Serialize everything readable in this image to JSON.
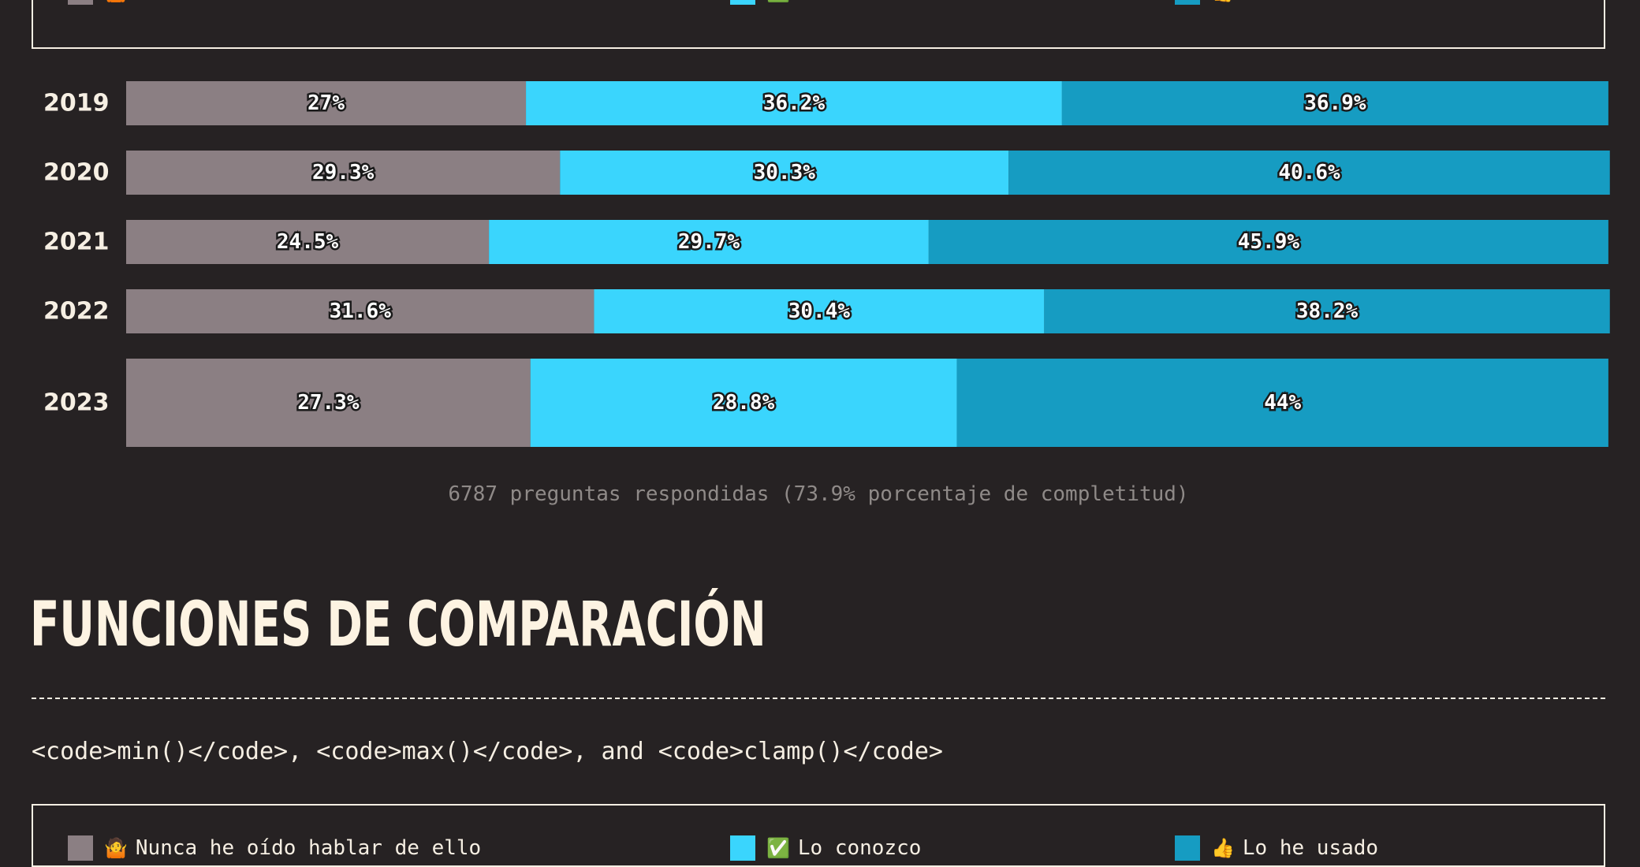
{
  "legend": {
    "items": [
      {
        "emoji": "🤷",
        "label": "Nunca he oído hablar de ello",
        "color": "#8b7f83"
      },
      {
        "emoji": "✅",
        "label": "Lo conozco",
        "color": "#3ad5fd"
      },
      {
        "emoji": "👍",
        "label": "Lo he usado",
        "color": "#169cc2"
      }
    ]
  },
  "chart_data": {
    "type": "bar",
    "orientation": "horizontal",
    "stacked": true,
    "normalized": true,
    "categories": [
      "2019",
      "2020",
      "2021",
      "2022",
      "2023"
    ],
    "series": [
      {
        "name": "Nunca he oído hablar de ello",
        "color": "#8b7f83",
        "values": [
          27,
          29.3,
          24.5,
          31.6,
          27.3
        ],
        "labels": [
          "27%",
          "29.3%",
          "24.5%",
          "31.6%",
          "27.3%"
        ]
      },
      {
        "name": "Lo conozco",
        "color": "#3ad5fd",
        "values": [
          36.2,
          30.3,
          29.7,
          30.4,
          28.8
        ],
        "labels": [
          "36.2%",
          "30.3%",
          "29.7%",
          "30.4%",
          "28.8%"
        ]
      },
      {
        "name": "Lo he usado",
        "color": "#169cc2",
        "values": [
          36.9,
          40.6,
          45.9,
          38.2,
          44
        ],
        "labels": [
          "36.9%",
          "40.6%",
          "45.9%",
          "38.2%",
          "44%"
        ]
      }
    ],
    "xlim": [
      0,
      100
    ]
  },
  "footnote": "6787 preguntas respondidas (73.9% porcentaje de completitud)",
  "section": {
    "title": "FUNCIONES DE COMPARACIÓN",
    "subtitle": "<code>min()</code>, <code>max()</code>, and <code>clamp()</code>"
  }
}
